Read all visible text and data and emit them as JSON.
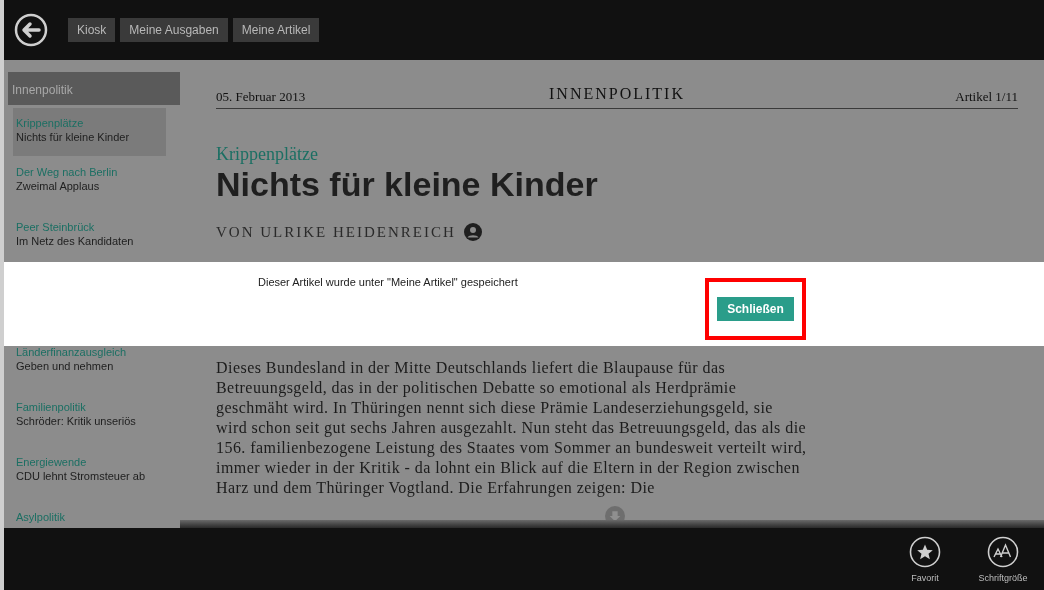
{
  "nav": {
    "tabs": [
      "Kiosk",
      "Meine Ausgaben",
      "Meine Artikel"
    ]
  },
  "sidebar": {
    "header": "Innenpolitik",
    "items": [
      {
        "kicker": "Krippenplätze",
        "title": "Nichts für kleine Kinder",
        "selected": true
      },
      {
        "kicker": "Der Weg nach Berlin",
        "title": "Zweimal Applaus",
        "selected": false
      },
      {
        "kicker": "Peer Steinbrück",
        "title": "Im Netz des Kandidaten",
        "selected": false
      },
      {
        "kicker": "Länderfinanzausgleich",
        "title": "Geben und nehmen",
        "selected": false
      },
      {
        "kicker": "Familienpolitik",
        "title": "Schröder: Kritik unseriös",
        "selected": false
      },
      {
        "kicker": "Energiewende",
        "title": "CDU lehnt Stromsteuer ab",
        "selected": false
      },
      {
        "kicker": "Asylpolitik",
        "selected": false
      }
    ]
  },
  "article": {
    "date": "05. Februar 2013",
    "section": "INNENPOLITIK",
    "counter": "Artikel 1/11",
    "kicker": "Krippenplätze",
    "title": "Nichts für kleine Kinder",
    "byline": "VON ULRIKE HEIDENREICH",
    "body": "Dieses Bundesland in der Mitte Deutschlands liefert die Blaupause für das Betreuungsgeld, das in der politischen Debatte so emotional als Herdprämie geschmäht wird. In Thüringen nennt sich diese Prämie Landeserziehungsgeld, sie wird schon seit gut sechs Jahren ausgezahlt. Nun steht das Betreuungsgeld, das als die 156. familienbezogene Leistung des Staates vom Sommer an bundesweit verteilt wird, immer wieder in der Kritik - da lohnt ein Blick auf die Eltern in der Region zwischen Harz und dem Thüringer Vogtland. Die Erfahrungen zeigen: Die"
  },
  "dialog": {
    "message": "Dieser Artikel wurde unter \"Meine Artikel\" gespeichert",
    "button": "Schließen"
  },
  "app_bar": [
    {
      "kind": "star",
      "label": "Favorit"
    },
    {
      "kind": "font",
      "label": "Schriftgröße"
    }
  ]
}
